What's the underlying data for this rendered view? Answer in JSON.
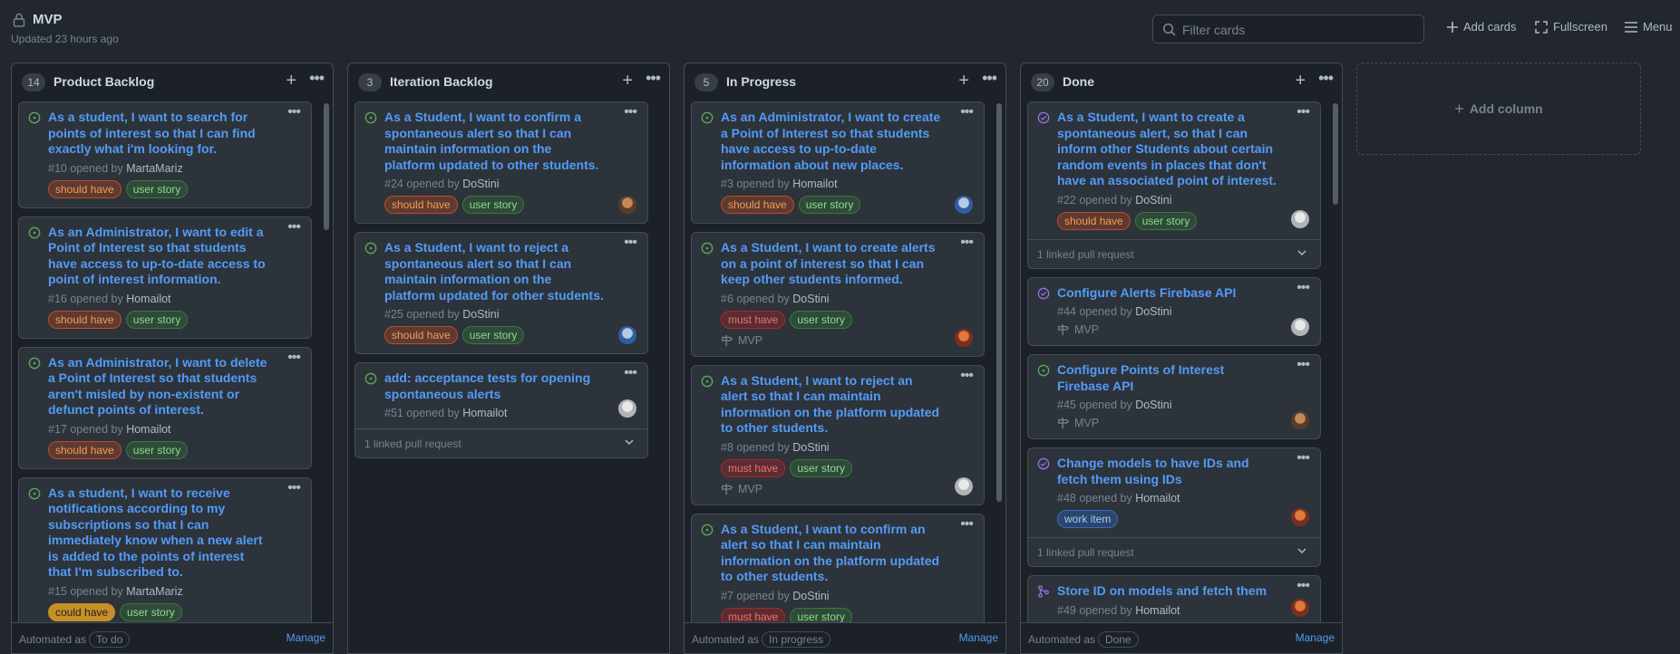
{
  "header": {
    "title": "MVP",
    "updated": "Updated 23 hours ago",
    "filter_placeholder": "Filter cards",
    "add_cards": "Add cards",
    "fullscreen": "Fullscreen",
    "menu": "Menu"
  },
  "add_column_label": "Add column",
  "columns": [
    {
      "count": "14",
      "name": "Product Backlog",
      "automated_as": "Automated as",
      "automation": "To do",
      "manage": "Manage",
      "cards": [
        {
          "title": "As a student, I want to search for points of interest so that I can find exactly what i'm looking for.",
          "meta": "#10 opened by",
          "author": "MartaMariz",
          "labels": [
            [
              "should have",
              "should"
            ],
            [
              "user story",
              "user"
            ]
          ]
        },
        {
          "title": "As an Administrator, I want to edit a Point of Interest so that students have access to up-to-date access to point of interest information.",
          "meta": "#16 opened by",
          "author": "Homailot",
          "labels": [
            [
              "should have",
              "should"
            ],
            [
              "user story",
              "user"
            ]
          ]
        },
        {
          "title": "As an Administrator, I want to delete a Point of Interest so that students aren't misled by non-existent or defunct points of interest.",
          "meta": "#17 opened by",
          "author": "Homailot",
          "labels": [
            [
              "should have",
              "should"
            ],
            [
              "user story",
              "user"
            ]
          ]
        },
        {
          "title": "As a student, I want to receive notifications according to my subscriptions so that I can immediately know when a new alert is added to the points of interest that I'm subscribed to.",
          "meta": "#15 opened by",
          "author": "MartaMariz",
          "labels": [
            [
              "could have",
              "could"
            ],
            [
              "user story",
              "user"
            ]
          ]
        }
      ]
    },
    {
      "count": "3",
      "name": "Iteration Backlog",
      "automated_as": "",
      "automation": "",
      "manage": "",
      "cards": [
        {
          "title": "As a Student, I want to confirm a spontaneous alert so that I can maintain information on the platform updated to other students.",
          "meta": "#24 opened by",
          "author": "DoStini",
          "labels": [
            [
              "should have",
              "should"
            ],
            [
              "user story",
              "user"
            ]
          ]
        },
        {
          "title": "As a Student, I want to reject a spontaneous alert so that I can maintain information on the platform updated for other students.",
          "meta": "#25 opened by",
          "author": "DoStini",
          "labels": [
            [
              "should have",
              "should"
            ],
            [
              "user story",
              "user"
            ]
          ]
        },
        {
          "title": "add: acceptance tests for opening spontaneous alerts",
          "meta": "#51 opened by",
          "author": "Homailot",
          "labels": [],
          "linked": "1 linked pull request"
        }
      ]
    },
    {
      "count": "5",
      "name": "In Progress",
      "automated_as": "Automated as",
      "automation": "In progress",
      "manage": "Manage",
      "cards": [
        {
          "title": "As an Administrator, I want to create a Point of Interest so that students have access to up-to-date information about new places.",
          "meta": "#3 opened by",
          "author": "Homailot",
          "labels": [
            [
              "should have",
              "should"
            ],
            [
              "user story",
              "user"
            ]
          ]
        },
        {
          "title": "As a Student, I want to create alerts on a point of interest so that I can keep other students informed.",
          "meta": "#6 opened by",
          "author": "DoStini",
          "labels": [
            [
              "must have",
              "must"
            ],
            [
              "user story",
              "user"
            ]
          ],
          "milestone": "MVP"
        },
        {
          "title": "As a Student, I want to reject an alert so that I can maintain information on the platform updated to other students.",
          "meta": "#8 opened by",
          "author": "DoStini",
          "labels": [
            [
              "must have",
              "must"
            ],
            [
              "user story",
              "user"
            ]
          ],
          "milestone": "MVP"
        },
        {
          "title": "As a Student, I want to confirm an alert so that I can maintain information on the platform updated to other students.",
          "meta": "#7 opened by",
          "author": "DoStini",
          "labels": [
            [
              "must have",
              "must"
            ],
            [
              "user story",
              "user"
            ]
          ]
        }
      ]
    },
    {
      "count": "20",
      "name": "Done",
      "automated_as": "Automated as",
      "automation": "Done",
      "manage": "Manage",
      "cards": [
        {
          "title": "As a Student, I want to create a spontaneous alert, so that I can inform other Students about certain random events in places that don't have an associated point of interest.",
          "meta": "#22 opened by",
          "author": "DoStini",
          "labels": [
            [
              "should have",
              "should"
            ],
            [
              "user story",
              "user"
            ]
          ],
          "linked": "1 linked pull request"
        },
        {
          "title": "Configure Alerts Firebase API",
          "meta": "#44 opened by",
          "author": "DoStini",
          "labels": [],
          "milestone": "MVP"
        },
        {
          "title": "Configure Points of Interest Firebase API",
          "meta": "#45 opened by",
          "author": "DoStini",
          "labels": [],
          "milestone": "MVP"
        },
        {
          "title": "Change models to have IDs and fetch them using IDs",
          "meta": "#48 opened by",
          "author": "Homailot",
          "labels": [
            [
              "work item",
              "work"
            ]
          ],
          "linked": "1 linked pull request"
        },
        {
          "title": "Store ID on models and fetch them",
          "meta": "#49 opened by",
          "author": "Homailot",
          "labels": []
        }
      ]
    }
  ]
}
